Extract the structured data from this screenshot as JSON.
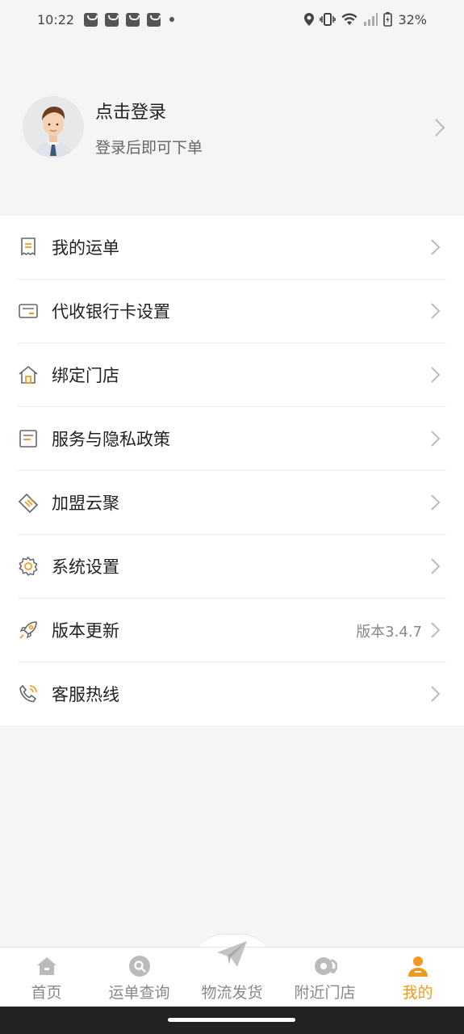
{
  "status_bar": {
    "time": "10:22",
    "battery": "32%"
  },
  "profile": {
    "title": "点击登录",
    "subtitle": "登录后即可下单"
  },
  "menu": {
    "items": [
      {
        "label": "我的运单",
        "icon": "waybill-icon"
      },
      {
        "label": "代收银行卡设置",
        "icon": "bank-card-icon"
      },
      {
        "label": "绑定门店",
        "icon": "store-home-icon"
      },
      {
        "label": "服务与隐私政策",
        "icon": "document-icon"
      },
      {
        "label": "加盟云聚",
        "icon": "handshake-icon"
      },
      {
        "label": "系统设置",
        "icon": "gear-icon"
      },
      {
        "label": "版本更新",
        "icon": "rocket-icon",
        "value": "版本3.4.7"
      },
      {
        "label": "客服热线",
        "icon": "phone-icon"
      }
    ]
  },
  "tabbar": {
    "tabs": [
      {
        "label": "首页",
        "icon": "home-icon"
      },
      {
        "label": "运单查询",
        "icon": "search-waybill-icon"
      },
      {
        "label": "物流发货",
        "icon": "paper-plane-icon"
      },
      {
        "label": "附近门店",
        "icon": "nearby-store-icon"
      },
      {
        "label": "我的",
        "icon": "user-icon",
        "active": true
      }
    ]
  },
  "colors": {
    "accent": "#f29a1f",
    "icon_gray": "#666666",
    "tab_gray": "#bbbbbb"
  }
}
